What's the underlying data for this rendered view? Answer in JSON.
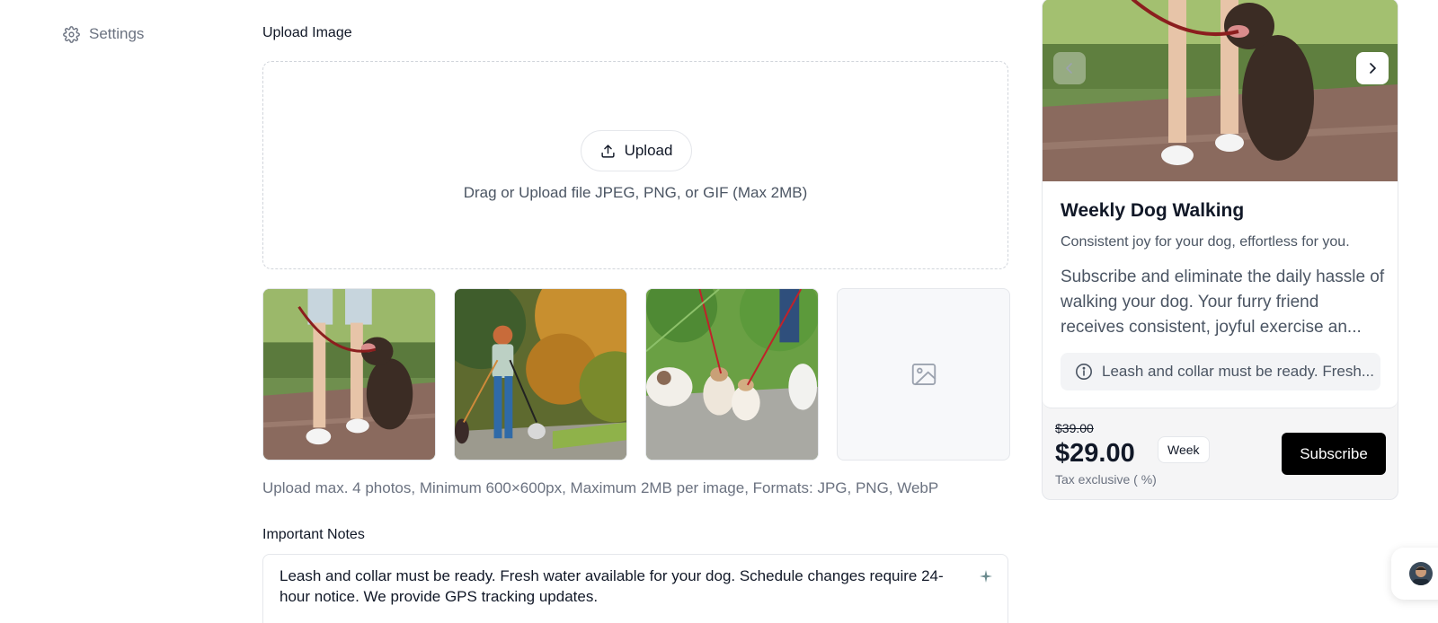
{
  "sidebar": {
    "settings_label": "Settings"
  },
  "upload": {
    "section_label": "Upload Image",
    "button_label": "Upload",
    "hint": "Drag or Upload file JPEG, PNG, or GIF (Max 2MB)",
    "rules": "Upload max. 4 photos, Minimum 600×600px, Maximum 2MB per image, Formats: JPG, PNG, WebP",
    "thumbnails": [
      {
        "name": "dog walking on brick path"
      },
      {
        "name": "woman walking dogs in park"
      },
      {
        "name": "group of small dogs on leash"
      },
      {
        "name": "empty image slot"
      }
    ]
  },
  "notes": {
    "section_label": "Important Notes",
    "value": "Leash and collar must be ready. Fresh water available for your dog. Schedule changes require 24-hour notice. We provide GPS tracking updates."
  },
  "card": {
    "title": "Weekly Dog Walking",
    "subtitle": "Consistent joy for your dog, effortless for you.",
    "description": "Subscribe and eliminate the daily hassle of walking your dog. Your furry friend receives consistent, joyful exercise an...",
    "note": "Leash and collar must be ready. Fresh...",
    "price_old": "$39.00",
    "price_new": "$29.00",
    "period": "Week",
    "tax_note": "Tax exclusive ( %)",
    "subscribe_label": "Subscribe"
  },
  "colors": {
    "accent": "#000000",
    "muted_text": "#6b7280",
    "border": "#e5e7eb"
  },
  "icons": {
    "settings": "gear-icon",
    "upload": "upload-icon",
    "empty_image": "image-placeholder-icon",
    "info": "info-icon",
    "sparkle": "sparkle-icon",
    "prev": "chevron-left-icon",
    "next": "chevron-right-icon"
  }
}
